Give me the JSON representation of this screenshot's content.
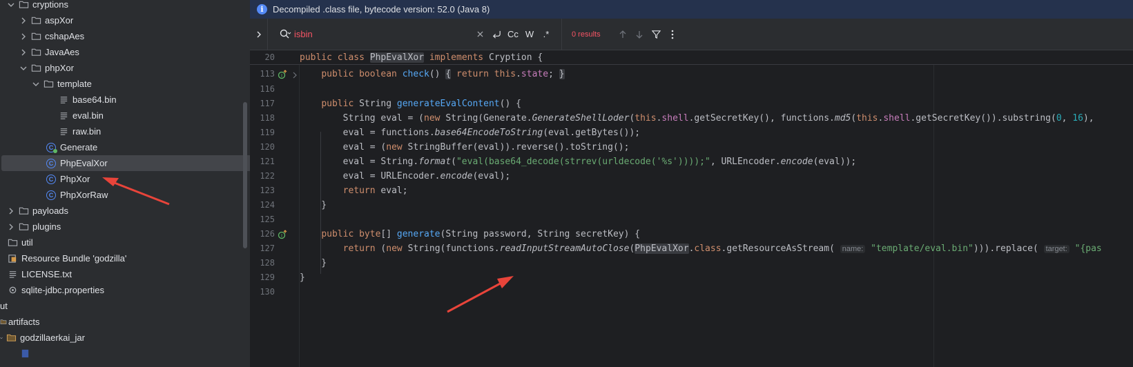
{
  "tree": {
    "items": [
      {
        "label": "cryptions",
        "icon": "folder-icon",
        "chevron": "down"
      },
      {
        "label": "aspXor",
        "icon": "folder-icon",
        "chevron": "right"
      },
      {
        "label": "cshapAes",
        "icon": "folder-icon",
        "chevron": "right"
      },
      {
        "label": "JavaAes",
        "icon": "folder-icon",
        "chevron": "right"
      },
      {
        "label": "phpXor",
        "icon": "folder-icon",
        "chevron": "down"
      },
      {
        "label": "template",
        "icon": "folder-icon",
        "chevron": "down"
      },
      {
        "label": "base64.bin",
        "icon": "text-file-icon"
      },
      {
        "label": "eval.bin",
        "icon": "text-file-icon"
      },
      {
        "label": "raw.bin",
        "icon": "text-file-icon"
      },
      {
        "label": "Generate",
        "icon": "runnable-class-icon"
      },
      {
        "label": "PhpEvalXor",
        "icon": "class-icon",
        "selected": true
      },
      {
        "label": "PhpXor",
        "icon": "class-icon"
      },
      {
        "label": "PhpXorRaw",
        "icon": "class-icon"
      },
      {
        "label": "payloads",
        "icon": "folder-icon",
        "chevron": "right"
      },
      {
        "label": "plugins",
        "icon": "folder-icon",
        "chevron": "right"
      },
      {
        "label": "util",
        "icon": "folder-icon"
      },
      {
        "label": "Resource Bundle 'godzilla'",
        "icon": "resource-bundle-icon"
      },
      {
        "label": "LICENSE.txt",
        "icon": "text-file-icon"
      },
      {
        "label": "sqlite-jdbc.properties",
        "icon": "properties-file-icon"
      },
      {
        "label": "ut",
        "icon": ""
      },
      {
        "label": "artifacts",
        "icon": "folder-icon"
      },
      {
        "label": "godzillaerkai_jar",
        "icon": "folder-icon",
        "chevron": "down"
      }
    ]
  },
  "banner": {
    "text": "Decompiled .class file, bytecode version: 52.0 (Java 8)",
    "icon": "info-icon"
  },
  "find": {
    "query": "isbin",
    "case_label": "Cc",
    "word_label": "W",
    "regex_label": ".*",
    "results": "0 results"
  },
  "code": {
    "sticky_line_number": "20",
    "line_numbers": [
      "113",
      "116",
      "117",
      "118",
      "119",
      "120",
      "121",
      "122",
      "123",
      "124",
      "125",
      "126",
      "127",
      "128",
      "129",
      "130"
    ],
    "hints": {
      "name": "name:",
      "target": "target:"
    }
  },
  "colors": {
    "keyword": "#cf8e6d",
    "method": "#56a8f5",
    "field": "#c77dbb",
    "string": "#6aab73",
    "number": "#2aacb8",
    "annotation_arrow": "#e8443a",
    "selection": "#43454a"
  }
}
